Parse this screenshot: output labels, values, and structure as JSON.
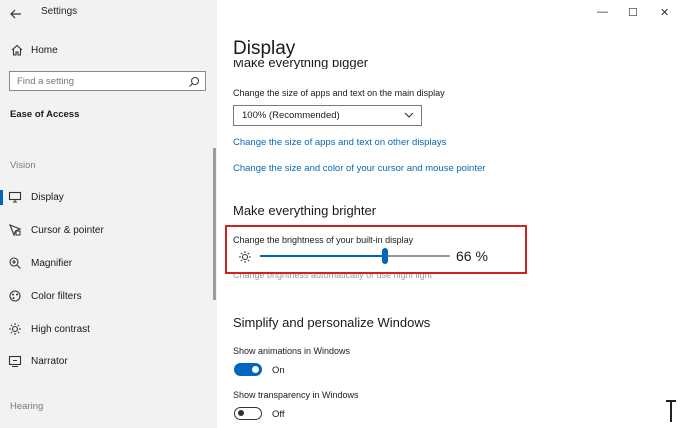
{
  "window": {
    "title": "Settings",
    "controls": {
      "minimize": "—",
      "maximize": "☐",
      "close": "✕"
    }
  },
  "sidebar": {
    "home_label": "Home",
    "search_placeholder": "Find a setting",
    "category_title": "Ease of Access",
    "vision_header": "Vision",
    "items": [
      {
        "label": "Display",
        "icon": "monitor-icon"
      },
      {
        "label": "Cursor & pointer",
        "icon": "cursor-icon"
      },
      {
        "label": "Magnifier",
        "icon": "magnifier-icon"
      },
      {
        "label": "Color filters",
        "icon": "color-filter-icon"
      },
      {
        "label": "High contrast",
        "icon": "high-contrast-icon"
      },
      {
        "label": "Narrator",
        "icon": "narrator-icon"
      }
    ],
    "hearing_header": "Hearing"
  },
  "main": {
    "page_title": "Display",
    "cut_section_title": "Make everything bigger",
    "size_label": "Change the size of apps and text on the main display",
    "size_dropdown_value": "100% (Recommended)",
    "link_other_displays": "Change the size of apps and text on other displays",
    "link_cursor": "Change the size and color of your cursor and mouse pointer",
    "brighter_title": "Make everything brighter",
    "brightness_label": "Change the brightness of your built-in display",
    "brightness_value": 66,
    "brightness_text": "66 %",
    "brightness_sub": "Change brightness automatically or use night light",
    "simplify_title": "Simplify and personalize Windows",
    "animations_label": "Show animations in Windows",
    "animations_state": "On",
    "transparency_label": "Show transparency in Windows",
    "transparency_state": "Off"
  },
  "colors": {
    "accent": "#0067c0",
    "link": "#0a68b5",
    "highlight_border": "#d32020",
    "sidebar_bg": "#f2f2f2"
  }
}
